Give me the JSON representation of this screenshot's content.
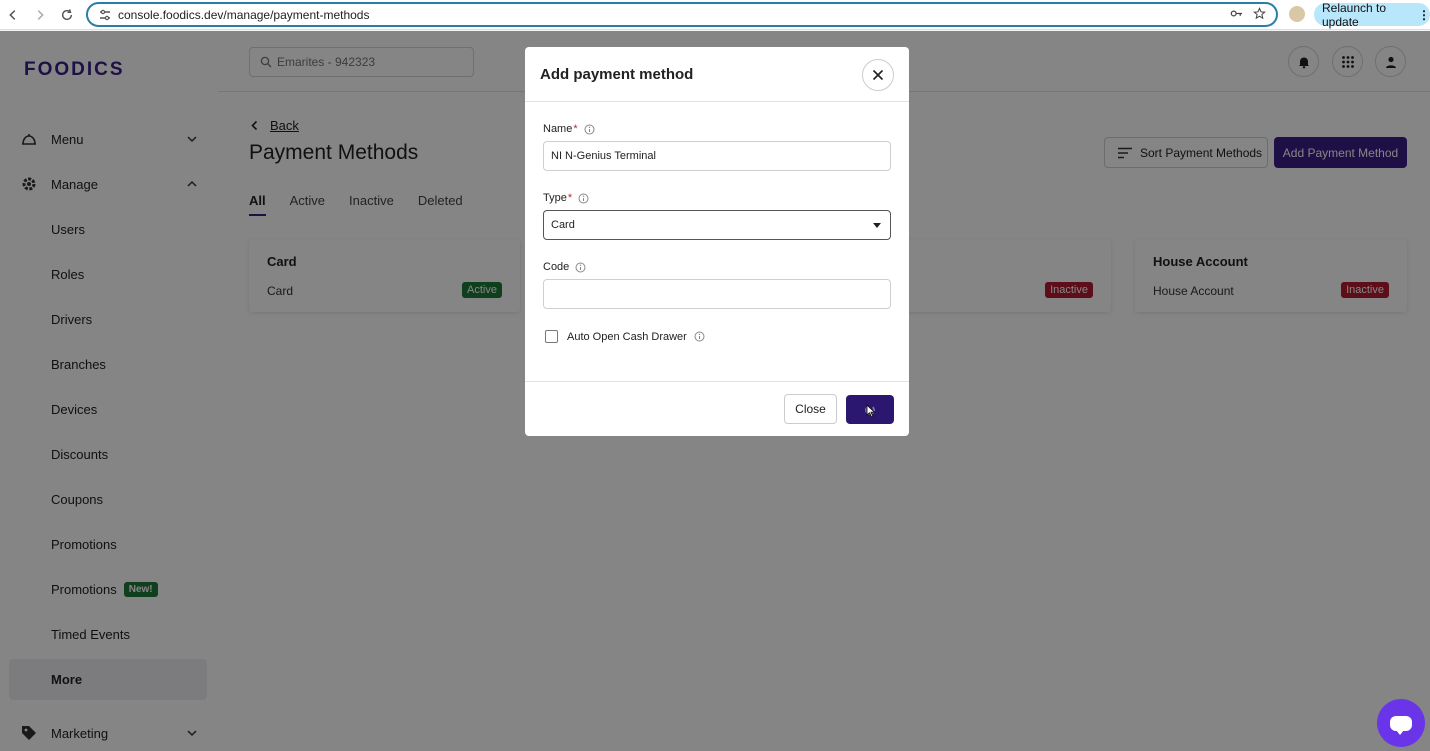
{
  "browser": {
    "url": "console.foodics.dev/manage/payment-methods",
    "relaunch_label": "Relaunch to update"
  },
  "sidebar": {
    "logo": "FOODICS",
    "sections": {
      "menu": "Menu",
      "manage": "Manage",
      "marketing": "Marketing"
    },
    "items": [
      "Users",
      "Roles",
      "Drivers",
      "Branches",
      "Devices",
      "Discounts",
      "Coupons",
      "Promotions",
      "Promotions",
      "Timed Events"
    ],
    "new_badge": "New!",
    "more": "More"
  },
  "topbar": {
    "search_placeholder": "Emarites - 942323"
  },
  "main": {
    "back": "Back",
    "title": "Payment Methods",
    "tabs": [
      "All",
      "Active",
      "Inactive",
      "Deleted"
    ],
    "sort_button": "Sort Payment Methods",
    "add_button": "Add Payment Method",
    "cards": [
      {
        "title": "Card",
        "type": "Card",
        "status": "Active"
      },
      {
        "title": "",
        "type": "",
        "status": "Inactive"
      },
      {
        "title": "House Account",
        "type": "House Account",
        "status": "Inactive"
      }
    ]
  },
  "modal": {
    "title": "Add payment method",
    "name_label": "Name",
    "name_value": "NI N-Genius Terminal",
    "type_label": "Type",
    "type_value": "Card",
    "code_label": "Code",
    "code_value": "",
    "required_mark": "*",
    "checkbox_label": "Auto Open Cash Drawer",
    "close_button": "Close"
  },
  "colors": {
    "brand": "#3a1e86",
    "active": "#1f7a3a",
    "inactive": "#b31b2e",
    "chat": "#6a35e8"
  }
}
